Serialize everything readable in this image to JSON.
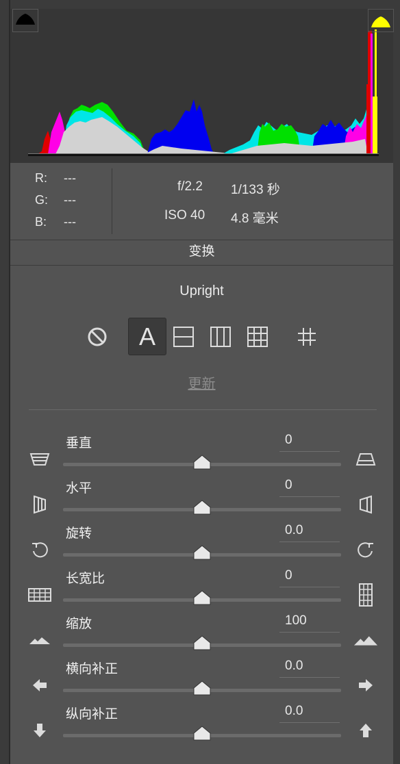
{
  "colors": {
    "panel": "#535353",
    "histogram_bg": "#363636",
    "highlight_clip": "#ffff00",
    "shadow_clip": "#000000"
  },
  "histogram": {
    "shadow_clipping_icon": "triangle-black-icon",
    "highlight_clipping_icon": "triangle-yellow-icon"
  },
  "info": {
    "r_label": "R:",
    "r_value": "---",
    "g_label": "G:",
    "g_value": "---",
    "b_label": "B:",
    "b_value": "---",
    "aperture": "f/2.2",
    "shutter": "1/133 秒",
    "iso": "ISO 40",
    "focal_length": "4.8 毫米"
  },
  "section": {
    "title": "变换"
  },
  "upright": {
    "title": "Upright",
    "buttons": [
      {
        "name": "off",
        "icon": "no-entry-icon",
        "active": false
      },
      {
        "name": "auto",
        "icon": "letter-a-icon",
        "active": true,
        "label": "A"
      },
      {
        "name": "level",
        "icon": "level-icon",
        "active": false
      },
      {
        "name": "vertical",
        "icon": "vertical-icon",
        "active": false
      },
      {
        "name": "full",
        "icon": "full-grid-icon",
        "active": false
      },
      {
        "name": "guided",
        "icon": "guided-crop-icon",
        "active": false
      }
    ],
    "update_label": "更新"
  },
  "sliders": [
    {
      "label": "垂直",
      "value": "0",
      "position": 0.5,
      "left_icon": "vertical-keystone-in-icon",
      "right_icon": "vertical-keystone-out-icon"
    },
    {
      "label": "水平",
      "value": "0",
      "position": 0.5,
      "left_icon": "horizontal-keystone-left-icon",
      "right_icon": "horizontal-keystone-right-icon"
    },
    {
      "label": "旋转",
      "value": "0.0",
      "position": 0.5,
      "left_icon": "rotate-ccw-icon",
      "right_icon": "rotate-cw-icon"
    },
    {
      "label": "长宽比",
      "value": "0",
      "position": 0.5,
      "left_icon": "aspect-wide-icon",
      "right_icon": "aspect-tall-icon"
    },
    {
      "label": "缩放",
      "value": "100",
      "position": 0.5,
      "left_icon": "mountain-small-icon",
      "right_icon": "mountain-large-icon"
    },
    {
      "label": "横向补正",
      "value": "0.0",
      "position": 0.5,
      "left_icon": "arrow-left-icon",
      "right_icon": "arrow-right-icon"
    },
    {
      "label": "纵向补正",
      "value": "0.0",
      "position": 0.5,
      "left_icon": "arrow-down-icon",
      "right_icon": "arrow-up-icon"
    }
  ]
}
